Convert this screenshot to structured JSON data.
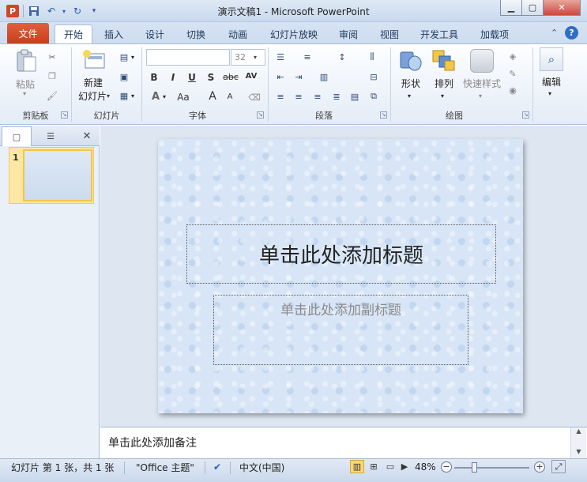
{
  "window": {
    "title": "演示文稿1 - Microsoft PowerPoint",
    "app_icon": "P"
  },
  "qat": {
    "save_icon": "save-icon",
    "undo_icon": "undo-icon",
    "redo_icon": "redo-icon"
  },
  "tabs": [
    {
      "label": "文件"
    },
    {
      "label": "开始"
    },
    {
      "label": "插入"
    },
    {
      "label": "设计"
    },
    {
      "label": "切换"
    },
    {
      "label": "动画"
    },
    {
      "label": "幻灯片放映"
    },
    {
      "label": "审阅"
    },
    {
      "label": "视图"
    },
    {
      "label": "开发工具"
    },
    {
      "label": "加载项"
    }
  ],
  "ribbon": {
    "clipboard": {
      "group": "剪贴板",
      "paste": "粘贴"
    },
    "slides": {
      "group": "幻灯片",
      "new_slide_line1": "新建",
      "new_slide_line2": "幻灯片"
    },
    "font": {
      "group": "字体",
      "font_name": "",
      "font_size": "32",
      "bold": "B",
      "italic": "I",
      "underline": "U",
      "shadow": "S",
      "strike": "abc",
      "spacing": "AV",
      "grow": "A",
      "shrink": "A",
      "case": "Aa"
    },
    "paragraph": {
      "group": "段落"
    },
    "drawing": {
      "group": "绘图",
      "shapes": "形状",
      "arrange": "排列",
      "quick_styles": "快速样式"
    },
    "editing": {
      "group": "编辑",
      "label": "编辑"
    }
  },
  "left_pane": {
    "slide_number": "1"
  },
  "slide": {
    "title_placeholder": "单击此处添加标题",
    "subtitle_placeholder": "单击此处添加副标题"
  },
  "notes": {
    "placeholder": "单击此处添加备注"
  },
  "status": {
    "slide_info": "幻灯片 第 1 张，共 1 张",
    "theme": "\"Office 主题\"",
    "language": "中文(中国)",
    "zoom": "48%"
  },
  "colors": {
    "file_tab": "#d04b27",
    "ribbon_bg": "#e4ecf7",
    "slide_bg": "#d7e5f6"
  }
}
